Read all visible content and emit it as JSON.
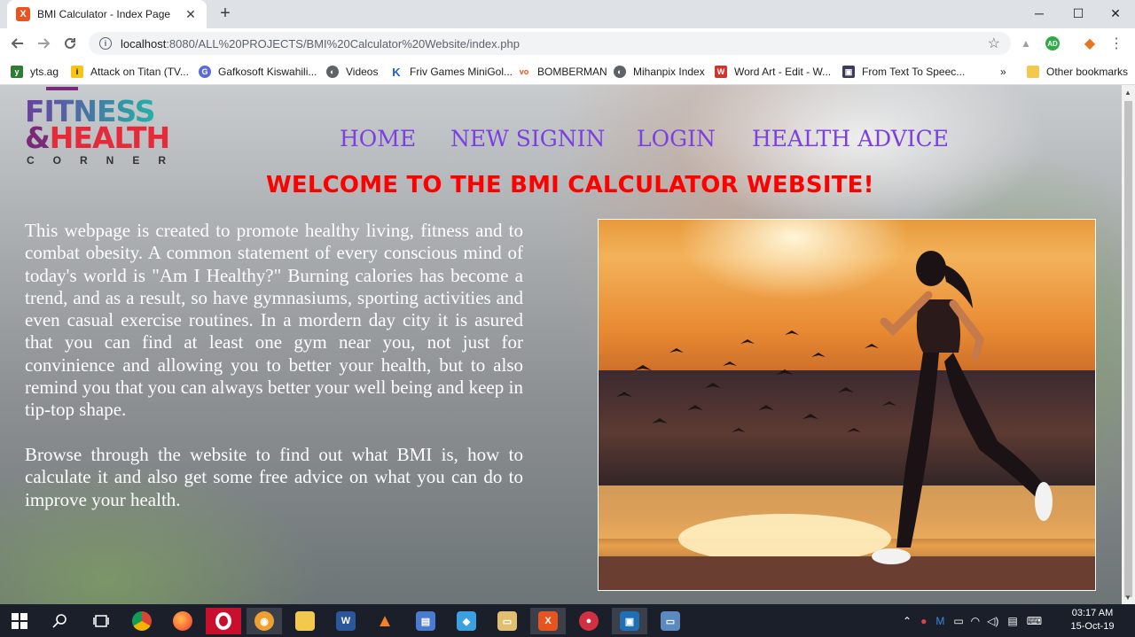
{
  "browser": {
    "tab_title": "BMI Calculator - Index Page",
    "tab_favicon": "X",
    "new_tab_label": "+",
    "window_controls": {
      "minimize": "─",
      "maximize": "☐",
      "close": "✕"
    },
    "url_host": "localhost",
    "url_rest": ":8080/ALL%20PROJECTS/BMI%20Calculator%20Website/index.php",
    "extensions": [
      "AD"
    ],
    "bookmarks": [
      {
        "label": "yts.ag",
        "icon": "yts",
        "color": "#2e7d32"
      },
      {
        "label": "Attack on Titan (TV...",
        "icon": "imdb",
        "color": "#f5c518"
      },
      {
        "label": "Gafkosoft Kiswahili...",
        "icon": "gafko",
        "color": "#5b6bd6"
      },
      {
        "label": "Videos",
        "icon": "globe",
        "color": "#5f6368"
      },
      {
        "label": "Friv Games MiniGol...",
        "icon": "K",
        "color": "#1a5fd6"
      },
      {
        "label": "BOMBERMAN",
        "icon": "vo",
        "color": "#e8541f"
      },
      {
        "label": "Mihanpix Index",
        "icon": "globe",
        "color": "#5f6368"
      },
      {
        "label": "Word Art - Edit - W...",
        "icon": "W",
        "color": "#d0342c"
      },
      {
        "label": "From Text To Speec...",
        "icon": "tts",
        "color": "#3b3b5a"
      }
    ],
    "bookmarks_overflow": "»",
    "other_bookmarks": "Other bookmarks"
  },
  "logo": {
    "line1": "FITNESS",
    "amp": "&",
    "line2": "HEALTH",
    "line3": "CORNER"
  },
  "nav": [
    "HOME",
    "NEW SIGNIN",
    "LOGIN",
    "HEALTH ADVICE"
  ],
  "welcome": "WELCOME TO THE BMI CALCULATOR WEBSITE!",
  "paragraphs": [
    "This webpage is created to promote healthy living, fitness and to combat obesity. A common statement of every conscious mind of today's world is \"Am I Healthy?\" Burning calories has become a trend, and as a result, so have gymnasiums, sporting activities and even casual exercise routines. In a mordern day city it is asured that you can find at least one gym near you, not just for convinience and allowing you to better your health, but to also remind you that you can always better your well being and keep in tip-top shape.",
    "Browse through the website to find out what BMI is, how to calculate it and also get some free advice on what you can do to improve your health."
  ],
  "taskbar": {
    "apps": [
      "start",
      "search",
      "task-view",
      "chrome",
      "firefox",
      "opera",
      "brave",
      "files",
      "word",
      "vlc",
      "network",
      "3d",
      "folder",
      "xampp",
      "app",
      "python",
      "explorer"
    ],
    "clock_time": "03:17 AM",
    "clock_date": "15-Oct-19"
  }
}
